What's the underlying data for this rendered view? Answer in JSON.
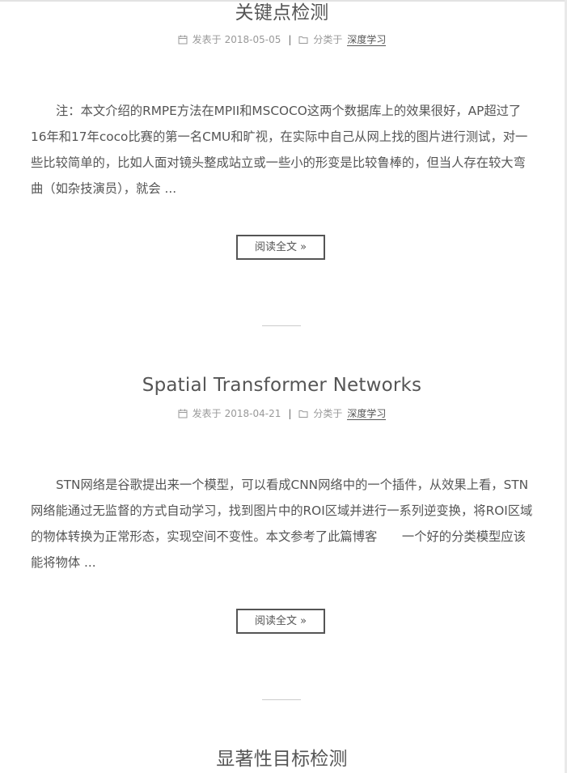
{
  "posts": [
    {
      "title": "关键点检测",
      "date_prefix": "发表于",
      "date": "2018-05-05",
      "category_prefix": "分类于",
      "category": "深度学习",
      "excerpt": "注：本文介绍的RMPE方法在MPII和MSCOCO这两个数据库上的效果很好，AP超过了16年和17年coco比赛的第一名CMU和旷视，在实际中自己从网上找的图片进行测试，对一些比较简单的，比如人面对镜头整成站立或一些小的形变是比较鲁棒的，但当人存在较大弯曲（如杂技演员），就会 ...",
      "read_more": "阅读全文 »"
    },
    {
      "title": "Spatial Transformer Networks",
      "date_prefix": "发表于",
      "date": "2018-04-21",
      "category_prefix": "分类于",
      "category": "深度学习",
      "excerpt": "STN网络是谷歌提出来一个模型，可以看成CNN网络中的一个插件，从效果上看，STN网络能通过无监督的方式自动学习，找到图片中的ROI区域并进行一系列逆变换，将ROI区域的物体转换为正常形态，实现空间不变性。本文参考了此篇博客　　一个好的分类模型应该能将物体 ...",
      "read_more": "阅读全文 »"
    },
    {
      "title": "显著性目标检测"
    }
  ],
  "icons": {
    "calendar": "calendar-icon",
    "folder": "folder-icon"
  },
  "separator": "|"
}
